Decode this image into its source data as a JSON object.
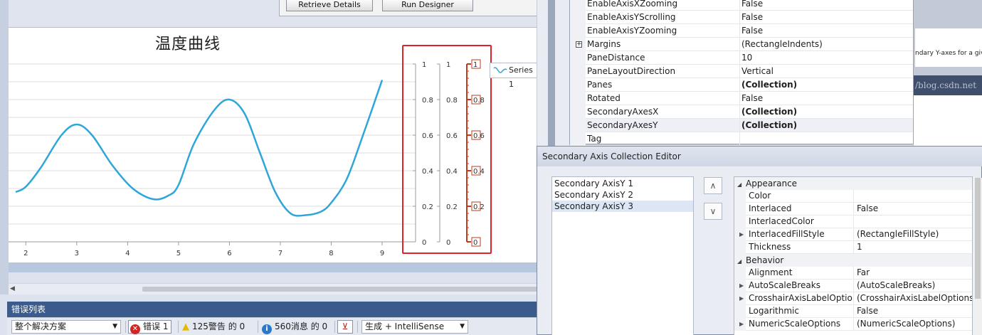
{
  "designer": {
    "buttons": [
      "Retrieve Details",
      "Run Designer"
    ]
  },
  "chart_data": {
    "type": "line",
    "title": "温度曲线",
    "x_ticks": [
      "2",
      "3",
      "4",
      "5",
      "6",
      "7",
      "8",
      "9"
    ],
    "y_ticks": [
      "0",
      "0.2",
      "0.4",
      "0.6",
      "0.8",
      "1"
    ],
    "xlim": [
      2,
      9
    ],
    "ylim": [
      0,
      1
    ],
    "series": [
      {
        "name": "Series 1",
        "x": [
          1.8,
          2.0,
          2.3,
          2.7,
          3.0,
          3.3,
          3.7,
          4.1,
          4.5,
          4.8,
          5.0,
          5.3,
          5.7,
          6.0,
          6.3,
          6.6,
          6.9,
          7.2,
          7.5,
          7.8,
          8.0,
          8.3,
          8.6,
          9.0
        ],
        "y": [
          0.28,
          0.31,
          0.42,
          0.6,
          0.66,
          0.6,
          0.43,
          0.3,
          0.24,
          0.26,
          0.32,
          0.55,
          0.74,
          0.8,
          0.72,
          0.5,
          0.28,
          0.16,
          0.15,
          0.17,
          0.22,
          0.35,
          0.58,
          0.91
        ]
      }
    ],
    "secondary_axes": [
      {
        "ticks": [
          "0",
          "0.2",
          "0.4",
          "0.6",
          "0.8",
          "1"
        ]
      },
      {
        "ticks": [
          "0",
          "0.2",
          "0.4",
          "0.6",
          "0.8",
          "1"
        ]
      },
      {
        "ticks": [
          "0",
          "0.2",
          "0.4",
          "0.6",
          "0.8",
          "1"
        ],
        "color": "#c0391b"
      }
    ],
    "legend": "top-right",
    "line_color": "#2ea6d9",
    "grid": true
  },
  "error_list": {
    "title": "错误列表",
    "scope": "整个解决方案",
    "errors": "错误 1",
    "warnings": "125警告 的 0",
    "messages": "560消息 的 0",
    "build": "生成 + IntelliSense"
  },
  "property_grid": {
    "rows": [
      {
        "name": "EnableAxisXZooming",
        "value": "False",
        "bold": false
      },
      {
        "name": "EnableAxisYScrolling",
        "value": "False",
        "bold": false
      },
      {
        "name": "EnableAxisYZooming",
        "value": "False",
        "bold": false
      },
      {
        "name": "Margins",
        "value": "(RectangleIndents)",
        "bold": false,
        "expandable": true
      },
      {
        "name": "PaneDistance",
        "value": "10",
        "bold": false
      },
      {
        "name": "PaneLayoutDirection",
        "value": "Vertical",
        "bold": false
      },
      {
        "name": "Panes",
        "value": "(Collection)",
        "bold": true
      },
      {
        "name": "Rotated",
        "value": "False",
        "bold": false
      },
      {
        "name": "SecondaryAxesX",
        "value": "(Collection)",
        "bold": true
      },
      {
        "name": "SecondaryAxesY",
        "value": "(Collection)",
        "bold": true,
        "selected": true
      },
      {
        "name": "Tag",
        "value": "",
        "bold": false
      }
    ]
  },
  "help_text": "ndary Y-axes for a give",
  "url_text": "/blog.csdn.net",
  "dialog": {
    "title": "Secondary Axis Collection Editor",
    "members": [
      "Secondary AxisY 1",
      "Secondary AxisY 2",
      "Secondary AxisY 3"
    ],
    "selected_index": 2,
    "up_glyph": "∧",
    "down_glyph": "∨",
    "categories": [
      {
        "name": "Appearance",
        "rows": [
          {
            "name": "Color",
            "value": ""
          },
          {
            "name": "Interlaced",
            "value": "False"
          },
          {
            "name": "InterlacedColor",
            "value": ""
          },
          {
            "name": "InterlacedFillStyle",
            "value": "(RectangleFillStyle)",
            "expandable": true
          },
          {
            "name": "Thickness",
            "value": "1"
          }
        ]
      },
      {
        "name": "Behavior",
        "rows": [
          {
            "name": "Alignment",
            "value": "Far"
          },
          {
            "name": "AutoScaleBreaks",
            "value": "(AutoScaleBreaks)",
            "expandable": true
          },
          {
            "name": "CrosshairAxisLabelOptions",
            "value": "(CrosshairAxisLabelOptions)",
            "expandable": true
          },
          {
            "name": "Logarithmic",
            "value": "False"
          },
          {
            "name": "NumericScaleOptions",
            "value": "(NumericScaleOptions)",
            "expandable": true
          }
        ]
      }
    ]
  }
}
